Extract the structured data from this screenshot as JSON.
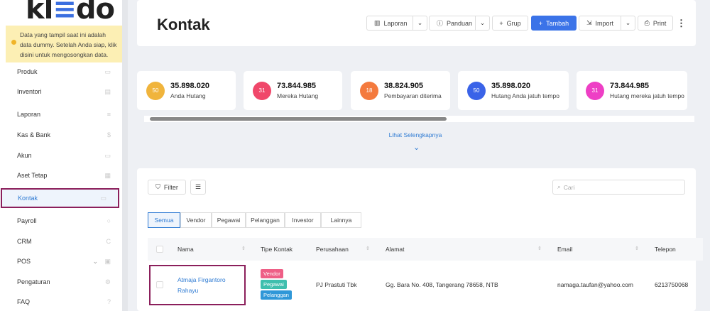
{
  "logo": {
    "pre": "kl",
    "mid": "≡",
    "post": "do"
  },
  "notice": "Data yang tampil saat ini adalah data dummy. Setelah Anda siap, klik disini untuk mengosongkan data.",
  "sidebar": {
    "items": [
      {
        "label": "Produk",
        "icon": "▭"
      },
      {
        "label": "Inventori",
        "icon": "▤"
      },
      {
        "label": "Laporan",
        "icon": "≡"
      },
      {
        "label": "Kas & Bank",
        "icon": "$"
      },
      {
        "label": "Akun",
        "icon": "▭"
      },
      {
        "label": "Aset Tetap",
        "icon": "▦"
      },
      {
        "label": "Kontak",
        "icon": "▭"
      },
      {
        "label": "Payroll",
        "icon": "○"
      },
      {
        "label": "CRM",
        "icon": "C"
      },
      {
        "label": "POS",
        "icon": "▣"
      },
      {
        "label": "Pengaturan",
        "icon": "⚙"
      },
      {
        "label": "FAQ",
        "icon": "?"
      }
    ]
  },
  "header": {
    "title": "Kontak",
    "buttons": {
      "laporan": "Laporan",
      "panduan": "Panduan",
      "grup": "Grup",
      "tambah": "Tambah",
      "import": "Import",
      "print": "Print"
    }
  },
  "stats": [
    {
      "count": "50",
      "value": "35.898.020",
      "label": "Anda Hutang",
      "color": "#f0b43c"
    },
    {
      "count": "31",
      "value": "73.844.985",
      "label": "Mereka Hutang",
      "color": "#f0476a"
    },
    {
      "count": "18",
      "value": "38.824.905",
      "label": "Pembayaran diterima",
      "color": "#f47a3e"
    },
    {
      "count": "50",
      "value": "35.898.020",
      "label": "Hutang Anda jatuh tempo",
      "color": "#3a63e8"
    },
    {
      "count": "31",
      "value": "73.844.985",
      "label": "Hutang mereka jatuh tempo",
      "color": "#ee3fc5"
    }
  ],
  "more": "Lihat Selengkapnya",
  "filter": "Filter",
  "search_placeholder": "Cari",
  "tabs": [
    "Semua",
    "Vendor",
    "Pegawai",
    "Pelanggan",
    "Investor",
    "Lainnya"
  ],
  "columns": [
    "Nama",
    "Tipe Kontak",
    "Perusahaan",
    "Alamat",
    "Email",
    "Telepon"
  ],
  "rows": [
    {
      "nama": "Atmaja Firgantoro Rahayu",
      "tipe": [
        "Vendor",
        "Pegawai",
        "Pelanggan"
      ],
      "perusahaan": "PJ Prastuti Tbk",
      "alamat": "Gg. Bara No. 408, Tangerang 78658, NTB",
      "email": "namaga.taufan@yahoo.com",
      "telepon": "6213750068"
    }
  ]
}
